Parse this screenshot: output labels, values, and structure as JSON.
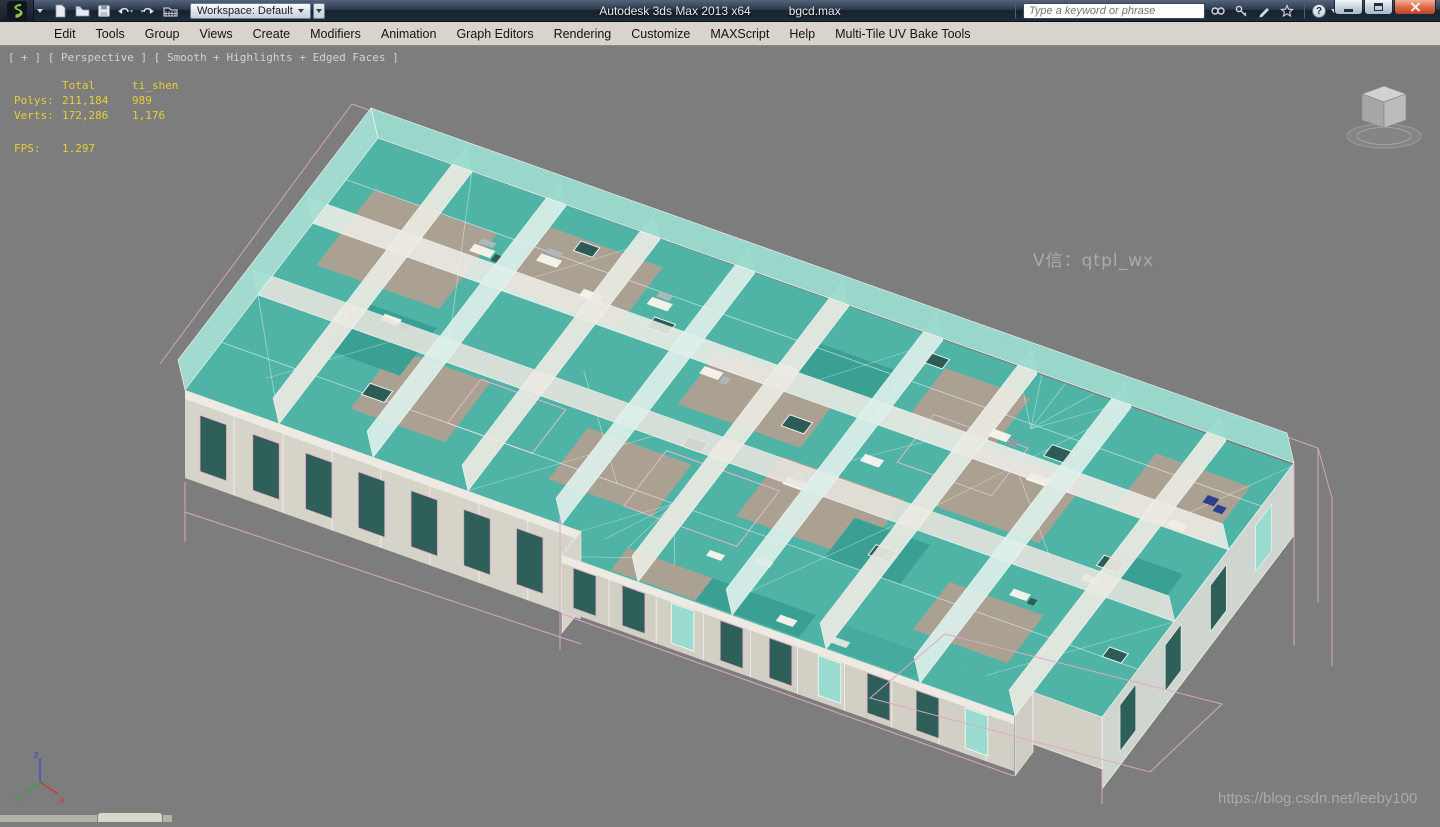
{
  "window": {
    "title_app": "Autodesk 3ds Max  2013 x64",
    "title_file": "bgcd.max",
    "workspace_label": "Workspace: Default",
    "search_placeholder": "Type a keyword or phrase",
    "help_glyph": "?"
  },
  "menu": {
    "items": [
      "Edit",
      "Tools",
      "Group",
      "Views",
      "Create",
      "Modifiers",
      "Animation",
      "Graph Editors",
      "Rendering",
      "Customize",
      "MAXScript",
      "Help",
      "Multi-Tile UV Bake Tools"
    ]
  },
  "viewport": {
    "label": "[ + ] [ Perspective ] [ Smooth + Highlights + Edged Faces ]",
    "stats": {
      "col_total": "Total",
      "col_selection": "ti_shen",
      "polys_label": "Polys:",
      "polys_total": "211,184",
      "polys_sel": "989",
      "verts_label": "Verts:",
      "verts_total": "172,286",
      "verts_sel": "1,176",
      "fps_label": "FPS:",
      "fps_value": "1.297"
    },
    "watermark_center": "V信：qtpl_wx",
    "watermark_bottom": "https://blog.csdn.net/leeby100",
    "axis": {
      "x": "x",
      "y": "y",
      "z": "z"
    }
  },
  "icons": [
    "3dsmax-logo-icon",
    "new-file-icon",
    "open-file-icon",
    "save-icon",
    "undo-icon",
    "redo-icon",
    "project-folder-icon",
    "search-icon",
    "key-icon",
    "pen-icon",
    "star-icon",
    "help-icon",
    "minimize-icon",
    "maximize-icon",
    "close-icon",
    "viewcube",
    "world-axis-tripod"
  ],
  "colors": {
    "viewport_background": "#7d7d7d",
    "model_teal": "#4fb4a6",
    "model_dark_teal": "#2d5c56",
    "model_beige": "#b2a091",
    "wireframe_pink": "#e2a6c8",
    "stats_yellow": "#e6cf35",
    "titlebar_dark": "#17222f",
    "close_button_red": "#bb4428"
  }
}
